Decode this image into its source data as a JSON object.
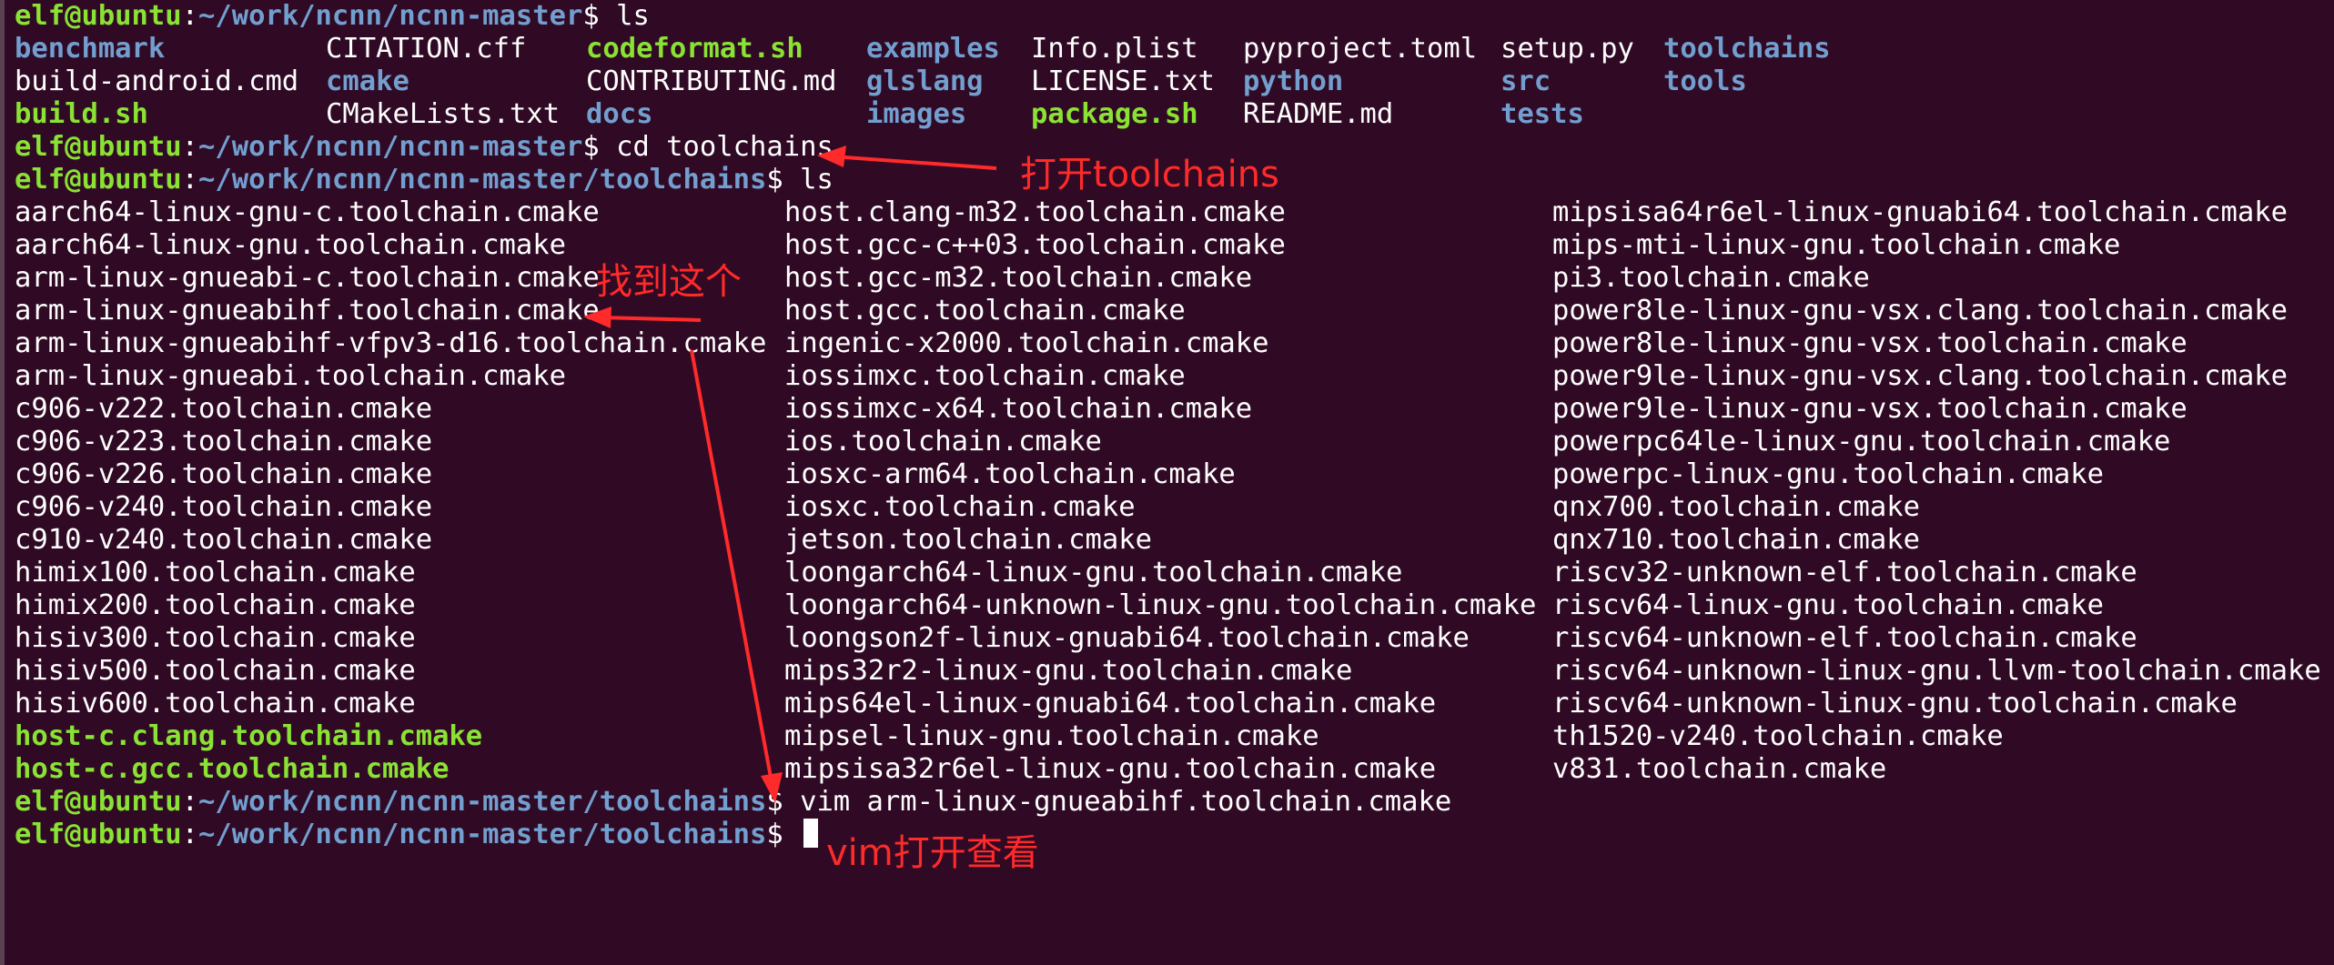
{
  "colors": {
    "background": "#300a24",
    "user": "#8ae234",
    "path": "#729fcf",
    "annotation": "#ff2a2a"
  },
  "prompt": {
    "user_host": "elf@ubuntu",
    "separator": ":",
    "dollar": "$ "
  },
  "commands": [
    {
      "path": "~/work/ncnn/ncnn-master",
      "command": "ls"
    },
    {
      "path": "~/work/ncnn/ncnn-master",
      "command": "cd toolchains"
    },
    {
      "path": "~/work/ncnn/ncnn-master/toolchains",
      "command": "ls"
    },
    {
      "path": "~/work/ncnn/ncnn-master/toolchains",
      "command": "vim arm-linux-gnueabihf.toolchain.cmake"
    },
    {
      "path": "~/work/ncnn/ncnn-master/toolchains",
      "command": ""
    }
  ],
  "ls_root": {
    "rows": [
      [
        {
          "t": "benchmark",
          "k": "dir"
        },
        {
          "t": "CITATION.cff",
          "k": "file"
        },
        {
          "t": "codeformat.sh",
          "k": "exe"
        },
        {
          "t": "examples",
          "k": "dir"
        },
        {
          "t": "Info.plist",
          "k": "file"
        },
        {
          "t": "pyproject.toml",
          "k": "file"
        },
        {
          "t": "setup.py",
          "k": "file"
        },
        {
          "t": "toolchains",
          "k": "dir"
        }
      ],
      [
        {
          "t": "build-android.cmd",
          "k": "file"
        },
        {
          "t": "cmake",
          "k": "dir"
        },
        {
          "t": "CONTRIBUTING.md",
          "k": "file"
        },
        {
          "t": "glslang",
          "k": "dir"
        },
        {
          "t": "LICENSE.txt",
          "k": "file"
        },
        {
          "t": "python",
          "k": "dir"
        },
        {
          "t": "src",
          "k": "dir"
        },
        {
          "t": "tools",
          "k": "dir"
        }
      ],
      [
        {
          "t": "build.sh",
          "k": "exe"
        },
        {
          "t": "CMakeLists.txt",
          "k": "file"
        },
        {
          "t": "docs",
          "k": "dir"
        },
        {
          "t": "images",
          "k": "dir"
        },
        {
          "t": "package.sh",
          "k": "exe"
        },
        {
          "t": "README.md",
          "k": "file"
        },
        {
          "t": "tests",
          "k": "dir"
        },
        {
          "t": "",
          "k": "file"
        }
      ]
    ]
  },
  "ls_toolchains": {
    "rows": [
      [
        {
          "t": "aarch64-linux-gnu-c.toolchain.cmake",
          "k": "file"
        },
        {
          "t": "host.clang-m32.toolchain.cmake",
          "k": "file"
        },
        {
          "t": "mipsisa64r6el-linux-gnuabi64.toolchain.cmake",
          "k": "file"
        }
      ],
      [
        {
          "t": "aarch64-linux-gnu.toolchain.cmake",
          "k": "file"
        },
        {
          "t": "host.gcc-c++03.toolchain.cmake",
          "k": "file"
        },
        {
          "t": "mips-mti-linux-gnu.toolchain.cmake",
          "k": "file"
        }
      ],
      [
        {
          "t": "arm-linux-gnueabi-c.toolchain.cmake",
          "k": "file"
        },
        {
          "t": "host.gcc-m32.toolchain.cmake",
          "k": "file"
        },
        {
          "t": "pi3.toolchain.cmake",
          "k": "file"
        }
      ],
      [
        {
          "t": "arm-linux-gnueabihf.toolchain.cmake",
          "k": "file"
        },
        {
          "t": "host.gcc.toolchain.cmake",
          "k": "file"
        },
        {
          "t": "power8le-linux-gnu-vsx.clang.toolchain.cmake",
          "k": "file"
        }
      ],
      [
        {
          "t": "arm-linux-gnueabihf-vfpv3-d16.toolchain.cmake",
          "k": "file"
        },
        {
          "t": "ingenic-x2000.toolchain.cmake",
          "k": "file"
        },
        {
          "t": "power8le-linux-gnu-vsx.toolchain.cmake",
          "k": "file"
        }
      ],
      [
        {
          "t": "arm-linux-gnueabi.toolchain.cmake",
          "k": "file"
        },
        {
          "t": "iossimxc.toolchain.cmake",
          "k": "file"
        },
        {
          "t": "power9le-linux-gnu-vsx.clang.toolchain.cmake",
          "k": "file"
        }
      ],
      [
        {
          "t": "c906-v222.toolchain.cmake",
          "k": "file"
        },
        {
          "t": "iossimxc-x64.toolchain.cmake",
          "k": "file"
        },
        {
          "t": "power9le-linux-gnu-vsx.toolchain.cmake",
          "k": "file"
        }
      ],
      [
        {
          "t": "c906-v223.toolchain.cmake",
          "k": "file"
        },
        {
          "t": "ios.toolchain.cmake",
          "k": "file"
        },
        {
          "t": "powerpc64le-linux-gnu.toolchain.cmake",
          "k": "file"
        }
      ],
      [
        {
          "t": "c906-v226.toolchain.cmake",
          "k": "file"
        },
        {
          "t": "iosxc-arm64.toolchain.cmake",
          "k": "file"
        },
        {
          "t": "powerpc-linux-gnu.toolchain.cmake",
          "k": "file"
        }
      ],
      [
        {
          "t": "c906-v240.toolchain.cmake",
          "k": "file"
        },
        {
          "t": "iosxc.toolchain.cmake",
          "k": "file"
        },
        {
          "t": "qnx700.toolchain.cmake",
          "k": "file"
        }
      ],
      [
        {
          "t": "c910-v240.toolchain.cmake",
          "k": "file"
        },
        {
          "t": "jetson.toolchain.cmake",
          "k": "file"
        },
        {
          "t": "qnx710.toolchain.cmake",
          "k": "file"
        }
      ],
      [
        {
          "t": "himix100.toolchain.cmake",
          "k": "file"
        },
        {
          "t": "loongarch64-linux-gnu.toolchain.cmake",
          "k": "file"
        },
        {
          "t": "riscv32-unknown-elf.toolchain.cmake",
          "k": "file"
        }
      ],
      [
        {
          "t": "himix200.toolchain.cmake",
          "k": "file"
        },
        {
          "t": "loongarch64-unknown-linux-gnu.toolchain.cmake",
          "k": "file"
        },
        {
          "t": "riscv64-linux-gnu.toolchain.cmake",
          "k": "file"
        }
      ],
      [
        {
          "t": "hisiv300.toolchain.cmake",
          "k": "file"
        },
        {
          "t": "loongson2f-linux-gnuabi64.toolchain.cmake",
          "k": "file"
        },
        {
          "t": "riscv64-unknown-elf.toolchain.cmake",
          "k": "file"
        }
      ],
      [
        {
          "t": "hisiv500.toolchain.cmake",
          "k": "file"
        },
        {
          "t": "mips32r2-linux-gnu.toolchain.cmake",
          "k": "file"
        },
        {
          "t": "riscv64-unknown-linux-gnu.llvm-toolchain.cmake",
          "k": "file"
        }
      ],
      [
        {
          "t": "hisiv600.toolchain.cmake",
          "k": "file"
        },
        {
          "t": "mips64el-linux-gnuabi64.toolchain.cmake",
          "k": "file"
        },
        {
          "t": "riscv64-unknown-linux-gnu.toolchain.cmake",
          "k": "file"
        }
      ],
      [
        {
          "t": "host-c.clang.toolchain.cmake",
          "k": "exe"
        },
        {
          "t": "mipsel-linux-gnu.toolchain.cmake",
          "k": "file"
        },
        {
          "t": "th1520-v240.toolchain.cmake",
          "k": "file"
        }
      ],
      [
        {
          "t": "host-c.gcc.toolchain.cmake",
          "k": "exe"
        },
        {
          "t": "mipsisa32r6el-linux-gnu.toolchain.cmake",
          "k": "file"
        },
        {
          "t": "v831.toolchain.cmake",
          "k": "file"
        }
      ]
    ]
  },
  "annotations": {
    "open_toolchains": "打开toolchains",
    "find_this": "找到这个",
    "vim_open": "vim打开查看"
  }
}
